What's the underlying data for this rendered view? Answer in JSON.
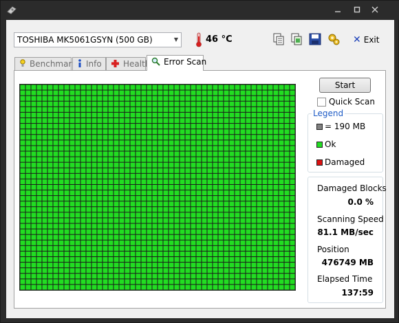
{
  "drive": {
    "selected": "TOSHIBA MK5061GSYN (500 GB)"
  },
  "temperature": "46 °C",
  "toolbar": {
    "exit_label": "Exit"
  },
  "tabs": [
    {
      "label": "Benchmark",
      "icon": "benchmark-icon",
      "active": false
    },
    {
      "label": "Info",
      "icon": "info-icon",
      "active": false
    },
    {
      "label": "Health",
      "icon": "health-icon",
      "active": false
    },
    {
      "label": "Error Scan",
      "icon": "magnifier-icon",
      "active": true
    }
  ],
  "scan": {
    "start_label": "Start",
    "quick_scan_label": "Quick Scan",
    "quick_scan_checked": false,
    "grid": {
      "columns": 50,
      "rows": 37,
      "ok_color": "#22dd22"
    }
  },
  "legend": {
    "title": "Legend",
    "block_size": "= 190 MB",
    "ok": "Ok",
    "damaged": "Damaged",
    "colors": {
      "block": "#808080",
      "ok": "#22dd22",
      "damaged": "#dd1111"
    }
  },
  "stats": {
    "damaged_blocks_label": "Damaged Blocks",
    "damaged_blocks_value": "0.0 %",
    "speed_label": "Scanning Speed",
    "speed_value": "81.1 MB/sec",
    "position_label": "Position",
    "position_value": "476749 MB",
    "elapsed_label": "Elapsed Time",
    "elapsed_value": "137:59"
  }
}
